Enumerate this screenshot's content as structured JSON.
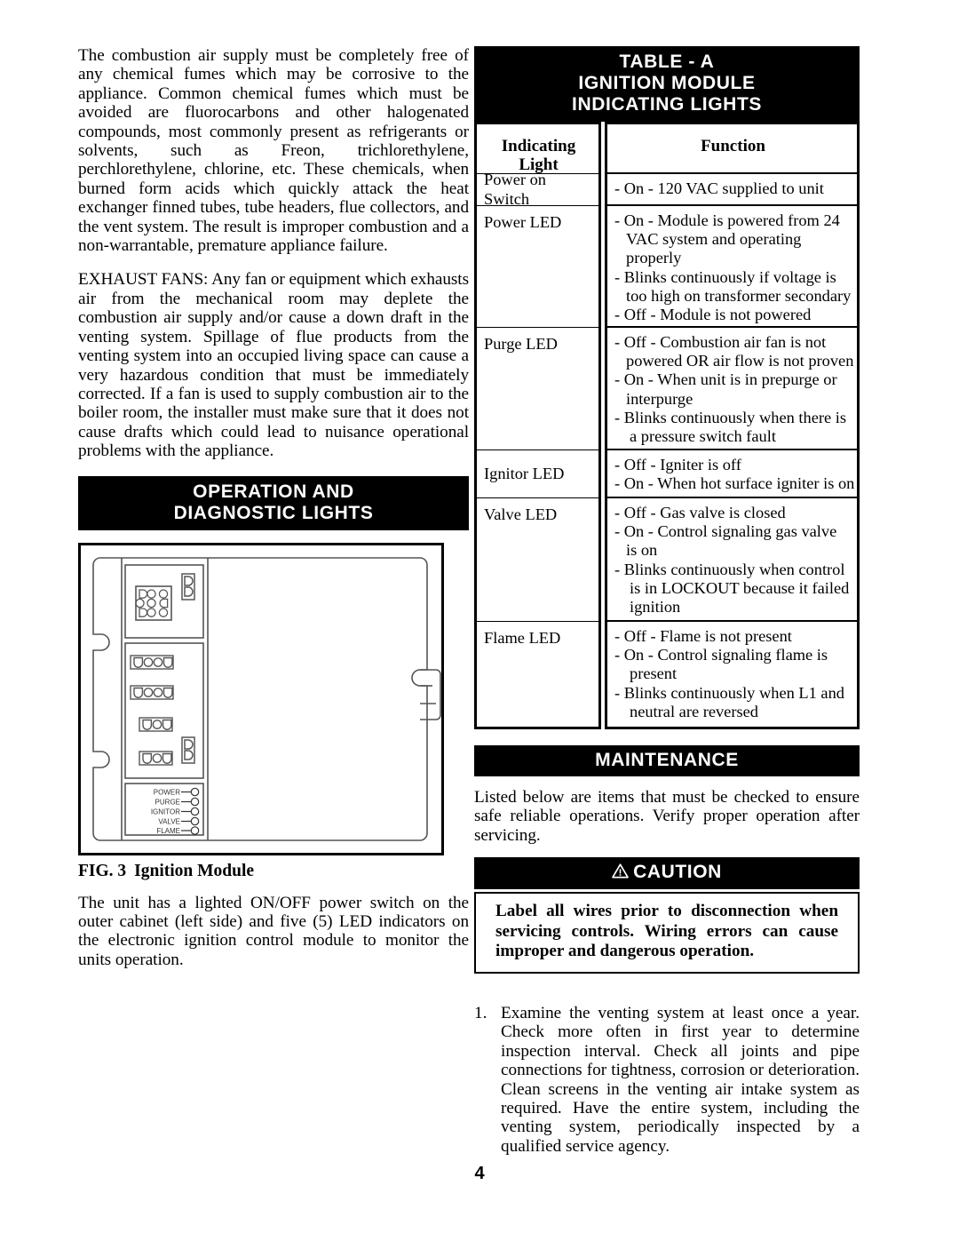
{
  "document": {
    "page_number": "4"
  },
  "left_column": {
    "paragraphs": [
      "The combustion air supply must be completely free of any chemical fumes which may be corrosive to the appliance. Common chemical fumes which must be avoided are fluorocarbons and other halogenated compounds, most commonly present as refrigerants or solvents, such as Freon, trichlorethylene, perchlorethylene, chlorine, etc. These chemicals, when burned form acids which quickly attack the heat exchanger finned tubes, tube headers, flue collectors, and the vent system. The result is improper combustion and a non-warrantable, premature appliance failure.",
      "EXHAUST FANS:  Any fan or equipment which exhausts air from the mechanical room may deplete the  combustion air supply and/or cause a down draft in the venting system. Spillage of flue products from the venting system into an occupied living space can cause a very hazardous condition that must be immediately corrected.  If a fan is used to supply combustion air to the boiler room, the installer must make sure that it does not cause drafts which could lead to nuisance operational problems with the appliance."
    ],
    "operation_banner": {
      "line1": "OPERATION AND",
      "line2": "DIAGNOSTIC LIGHTS"
    },
    "figure": {
      "led_labels": [
        "POWER",
        "PURGE",
        "IGNITOR",
        "VALVE",
        "FLAME"
      ],
      "caption_number": "FIG. 3",
      "caption_title": "Ignition Module"
    },
    "closing_paragraph": "The unit has a lighted ON/OFF power switch on the outer cabinet (left side) and five (5) LED indicators on the electronic ignition control module to monitor the units operation."
  },
  "right_column": {
    "table_banner": {
      "line1": "TABLE - A",
      "line2": "IGNITION MODULE",
      "line3": "INDICATING LIGHTS"
    },
    "table": {
      "headers": [
        "Indicating Light",
        "Function"
      ],
      "rows": [
        {
          "light": "Power on Switch",
          "function_lines": [
            {
              "text": "- On - 120 VAC supplied to unit",
              "indent": 0
            }
          ]
        },
        {
          "light": "Power LED",
          "function_lines": [
            {
              "text": "- On - Module is powered from 24",
              "indent": 0
            },
            {
              "text": "VAC system and operating",
              "indent": 1
            },
            {
              "text": "properly",
              "indent": 1
            },
            {
              "text": "- Blinks continuously if voltage is",
              "indent": 0
            },
            {
              "text": "too high on transformer secondary",
              "indent": 1
            },
            {
              "text": "- Off - Module is not powered",
              "indent": 0
            }
          ]
        },
        {
          "light": "Purge LED",
          "function_lines": [
            {
              "text": "- Off - Combustion air fan is not",
              "indent": 0
            },
            {
              "text": "powered OR air flow is not proven",
              "indent": 1
            },
            {
              "text": "- On - When unit is in prepurge or",
              "indent": 0
            },
            {
              "text": "interpurge",
              "indent": 1
            },
            {
              "text": "- Blinks continuously when there is",
              "indent": 0
            },
            {
              "text": "a pressure switch fault",
              "indent": 2
            }
          ]
        },
        {
          "light": "Ignitor LED",
          "function_lines": [
            {
              "text": "- Off - Igniter is off",
              "indent": 0
            },
            {
              "text": "- On - When hot surface igniter is on",
              "indent": 0
            }
          ]
        },
        {
          "light": "Valve LED",
          "function_lines": [
            {
              "text": "- Off - Gas valve is closed",
              "indent": 0
            },
            {
              "text": "- On - Control signaling gas valve",
              "indent": 0
            },
            {
              "text": "is on",
              "indent": 1
            },
            {
              "text": "- Blinks continuously when control",
              "indent": 0
            },
            {
              "text": "is in LOCKOUT because it failed",
              "indent": 2
            },
            {
              "text": "ignition",
              "indent": 2
            }
          ]
        },
        {
          "light": "Flame LED",
          "function_lines": [
            {
              "text": "- Off - Flame is not present",
              "indent": 0
            },
            {
              "text": "- On - Control signaling flame is",
              "indent": 0
            },
            {
              "text": "present",
              "indent": 2
            },
            {
              "text": "- Blinks continuously when L1 and",
              "indent": 0
            },
            {
              "text": "neutral are reversed",
              "indent": 2
            }
          ]
        }
      ]
    },
    "maintenance": {
      "banner": "MAINTENANCE",
      "intro": "Listed below are items that must be checked to ensure safe reliable operations.  Verify proper operation after servicing."
    },
    "caution": {
      "banner": "CAUTION",
      "icon": "warning-triangle-icon",
      "text": "Label all wires prior to disconnection when servicing controls. Wiring errors can cause improper and dangerous operation."
    },
    "numbered_items": [
      {
        "number": "1.",
        "text": "Examine the venting system at least once a year.  Check more often in first year to determine inspection interval. Check all joints and pipe connections for tightness, corrosion or deterioration. Clean screens in the venting air intake system as required. Have the entire system, including the venting system, periodically inspected by a qualified service agency."
      }
    ]
  }
}
